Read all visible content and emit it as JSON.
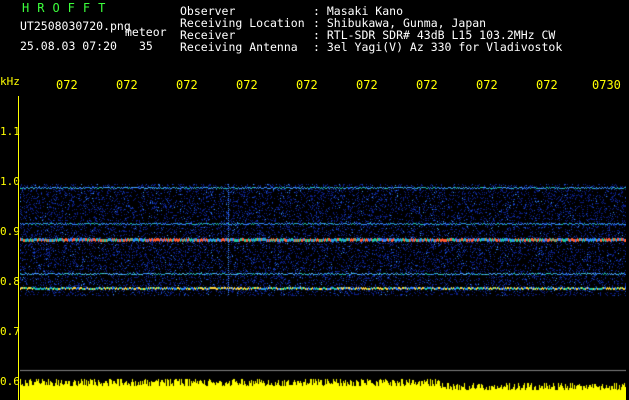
{
  "header": {
    "brand": "HROFFT",
    "filename": "UT2508030720.png",
    "mode": "meteor",
    "datetime": "25.08.03 07:20",
    "count": "35"
  },
  "info": [
    {
      "label": "Observer",
      "value": ": Masaki Kano"
    },
    {
      "label": "Receiving Location",
      "value": ": Shibukawa, Gunma, Japan"
    },
    {
      "label": "Receiver",
      "value": ": RTL-SDR SDR# 43dB L15 103.2MHz CW"
    },
    {
      "label": "Receiving Antenna",
      "value": ": 3el Yagi(V) Az 330 for Vladivostok"
    }
  ],
  "time_ticks": [
    "072",
    "072",
    "072",
    "072",
    "072",
    "072",
    "072",
    "072",
    "072",
    "0730"
  ],
  "yaxis": {
    "unit": "kHz",
    "labels": [
      "1.1",
      "1.0",
      "0.9",
      "0.8",
      "0.7",
      "0.6"
    ]
  },
  "colors": {
    "text": "#ffffff",
    "accent": "#3cff3c",
    "axis": "#ffff00",
    "background": "#000000"
  }
}
